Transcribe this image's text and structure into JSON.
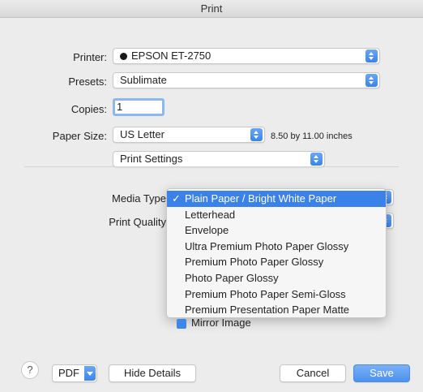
{
  "window": {
    "title": "Print"
  },
  "printer": {
    "label": "Printer:",
    "value": "EPSON ET-2750"
  },
  "presets": {
    "label": "Presets:",
    "value": "Sublimate"
  },
  "copies": {
    "label": "Copies:",
    "value": "1"
  },
  "paper_size": {
    "label": "Paper Size:",
    "value": "US Letter",
    "dimensions": "8.50 by 11.00 inches"
  },
  "section": {
    "value": "Print Settings"
  },
  "media_type": {
    "label": "Media Type"
  },
  "print_quality": {
    "label": "Print Quality"
  },
  "media_menu": {
    "items": [
      {
        "label": "Plain Paper / Bright White Paper",
        "selected": true,
        "checkmark": "✓"
      },
      {
        "label": "Letterhead"
      },
      {
        "label": "Envelope"
      },
      {
        "label": "Ultra Premium Photo Paper Glossy"
      },
      {
        "label": "Premium Photo Paper Glossy"
      },
      {
        "label": "Photo Paper Glossy"
      },
      {
        "label": "Premium Photo Paper Semi-Gloss"
      },
      {
        "label": "Premium Presentation Paper Matte"
      }
    ]
  },
  "mirror": {
    "label": "Mirror Image",
    "checked": true
  },
  "footer": {
    "help_label": "?",
    "pdf_label": "PDF",
    "hide_details_label": "Hide Details",
    "cancel_label": "Cancel",
    "save_label": "Save"
  },
  "colors": {
    "accent": "#3a82e8"
  }
}
